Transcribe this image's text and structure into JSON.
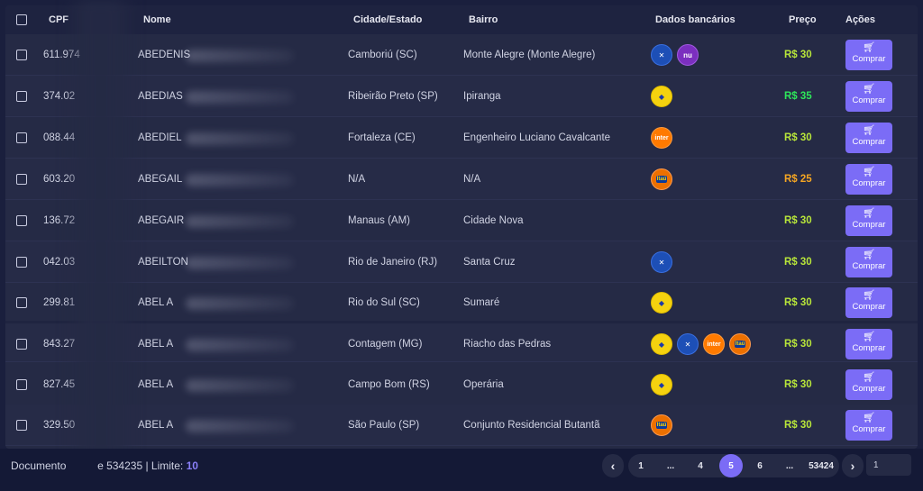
{
  "columns": {
    "cpf": "CPF",
    "nome": "Nome",
    "cidade": "Cidade/Estado",
    "bairro": "Bairro",
    "bancos": "Dados bancários",
    "preco": "Preço",
    "acoes": "Ações"
  },
  "buy_label": "Comprar",
  "rows": [
    {
      "cpf": "611.974",
      "nome": "ABEDENIS",
      "cidade": "Camboriú (SC)",
      "bairro": "Monte Alegre (Monte Alegre)",
      "banks": [
        "caixa",
        "nubank"
      ],
      "preco": "R$ 30",
      "price_color": "#b8e63a"
    },
    {
      "cpf": "374.02",
      "nome": "ABEDIAS",
      "cidade": "Ribeirão Preto (SP)",
      "bairro": "Ipiranga",
      "banks": [
        "bb"
      ],
      "preco": "R$ 35",
      "price_color": "#2ee65a"
    },
    {
      "cpf": "088.44",
      "nome": "ABEDIEL",
      "cidade": "Fortaleza (CE)",
      "bairro": "Engenheiro Luciano Cavalcante",
      "banks": [
        "inter"
      ],
      "preco": "R$ 30",
      "price_color": "#b8e63a"
    },
    {
      "cpf": "603.20",
      "nome": "ABEGAIL",
      "cidade": "N/A",
      "bairro": "N/A",
      "banks": [
        "itau"
      ],
      "preco": "R$ 25",
      "price_color": "#f5a623"
    },
    {
      "cpf": "136.72",
      "nome": "ABEGAIR",
      "cidade": "Manaus (AM)",
      "bairro": "Cidade Nova",
      "banks": [],
      "preco": "R$ 30",
      "price_color": "#b8e63a"
    },
    {
      "cpf": "042.03",
      "nome": "ABEILTON",
      "cidade": "Rio de Janeiro (RJ)",
      "bairro": "Santa Cruz",
      "banks": [
        "caixa"
      ],
      "preco": "R$ 30",
      "price_color": "#b8e63a"
    },
    {
      "cpf": "299.81",
      "nome": "ABEL A",
      "cidade": "Rio do Sul (SC)",
      "bairro": "Sumaré",
      "banks": [
        "bb"
      ],
      "preco": "R$ 30",
      "price_color": "#b8e63a"
    },
    {
      "cpf": "843.27",
      "nome": "ABEL A",
      "cidade": "Contagem (MG)",
      "bairro": "Riacho das Pedras",
      "banks": [
        "bb",
        "caixa",
        "inter",
        "itau"
      ],
      "preco": "R$ 30",
      "price_color": "#b8e63a"
    },
    {
      "cpf": "827.45",
      "nome": "ABEL A",
      "cidade": "Campo Bom (RS)",
      "bairro": "Operária",
      "banks": [
        "bb"
      ],
      "preco": "R$ 30",
      "price_color": "#b8e63a"
    },
    {
      "cpf": "329.50",
      "nome": "ABEL A",
      "cidade": "São Paulo (SP)",
      "bairro": "Conjunto Residencial Butantã",
      "banks": [
        "itau"
      ],
      "preco": "R$ 30",
      "price_color": "#b8e63a"
    }
  ],
  "bank_glyphs": {
    "caixa": "✕",
    "nubank": "nu",
    "bb": "◆",
    "inter": "inter",
    "itau": "Itaú"
  },
  "footer": {
    "doc_prefix": "Documento",
    "doc_suffix": "e 534235 | Limite:",
    "limit": "10"
  },
  "pagination": {
    "prev": "‹",
    "next": "›",
    "pages": [
      "1",
      "...",
      "4",
      "5",
      "6",
      "...",
      "53424"
    ],
    "active": "5",
    "input_value": "1"
  }
}
